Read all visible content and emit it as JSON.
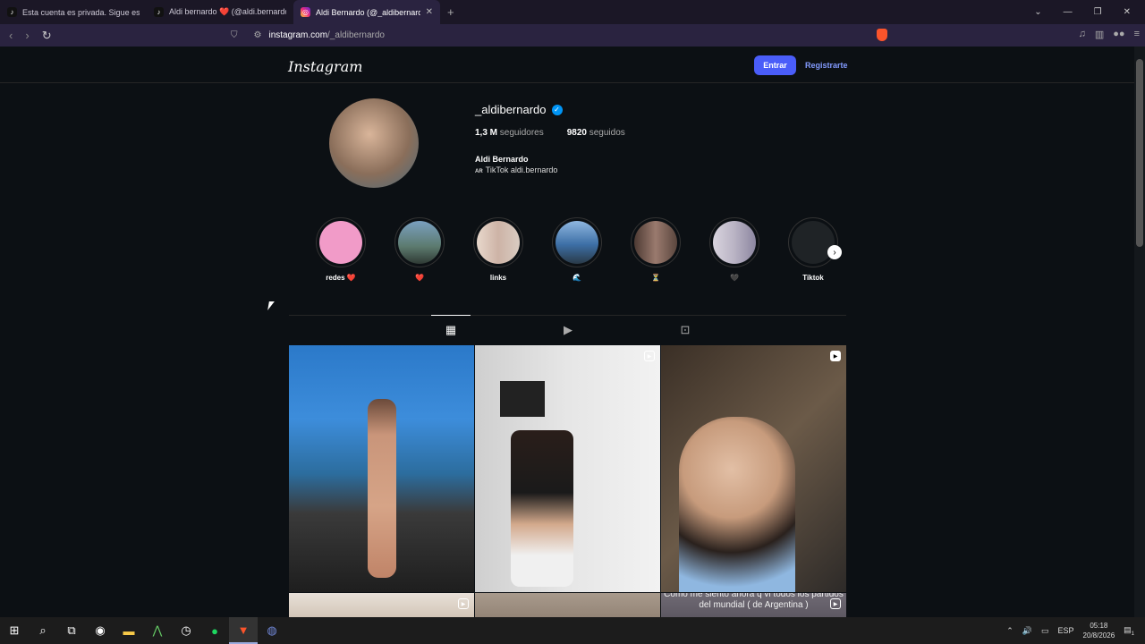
{
  "browser": {
    "tabs": [
      {
        "title": "Esta cuenta es privada. Sigue esta cu",
        "icon": "tiktok-icon",
        "active": false
      },
      {
        "title": "Aldi bernardo ❤️ (@aldi.bernardo) |",
        "icon": "tiktok-icon",
        "active": false
      },
      {
        "title": "Aldi Bernardo (@_aldibernardo)",
        "icon": "instagram-icon",
        "active": true
      }
    ],
    "new_tab": "+",
    "url_domain": "instagram.com",
    "url_path": "/_aldibernardo"
  },
  "header": {
    "logo": "Instagram",
    "login_label": "Entrar",
    "register_label": "Registrarte"
  },
  "profile": {
    "username": "_aldibernardo",
    "verified": true,
    "followers_count": "1,3 M",
    "followers_label": "seguidores",
    "following_count": "9820",
    "following_label": "seguidos",
    "full_name": "Aldi Bernardo",
    "bio_flag": "AR",
    "bio_text": "TikTok aldi.bernardo"
  },
  "highlights": [
    {
      "label": "redes ❤️",
      "color": "#f19bc8"
    },
    {
      "label": "❤️",
      "color": "#5c7a6e"
    },
    {
      "label": "links",
      "color": "#cdb3a6"
    },
    {
      "label": "🌊",
      "color": "#3d6fa6"
    },
    {
      "label": "⏳",
      "color": "#9a7a6e"
    },
    {
      "label": "🖤",
      "color": "#b9b3c4"
    },
    {
      "label": "Tiktok",
      "color": "#1f2326"
    }
  ],
  "post_tabs": [
    "posts-tab",
    "reels-tab",
    "tagged-tab"
  ],
  "posts": [
    {
      "type": "photo",
      "caption": ""
    },
    {
      "type": "reel",
      "caption": ""
    },
    {
      "type": "reel",
      "caption": ""
    },
    {
      "type": "reel",
      "caption": ""
    },
    {
      "type": "photo",
      "caption": ""
    },
    {
      "type": "reel",
      "caption": "Como me siento ahora q vi todos los partidos del mundial ( de Argentina )"
    }
  ],
  "taskbar": {
    "language": "ESP",
    "time": "05:18",
    "date": "20/8/2026",
    "notifications": "1"
  }
}
